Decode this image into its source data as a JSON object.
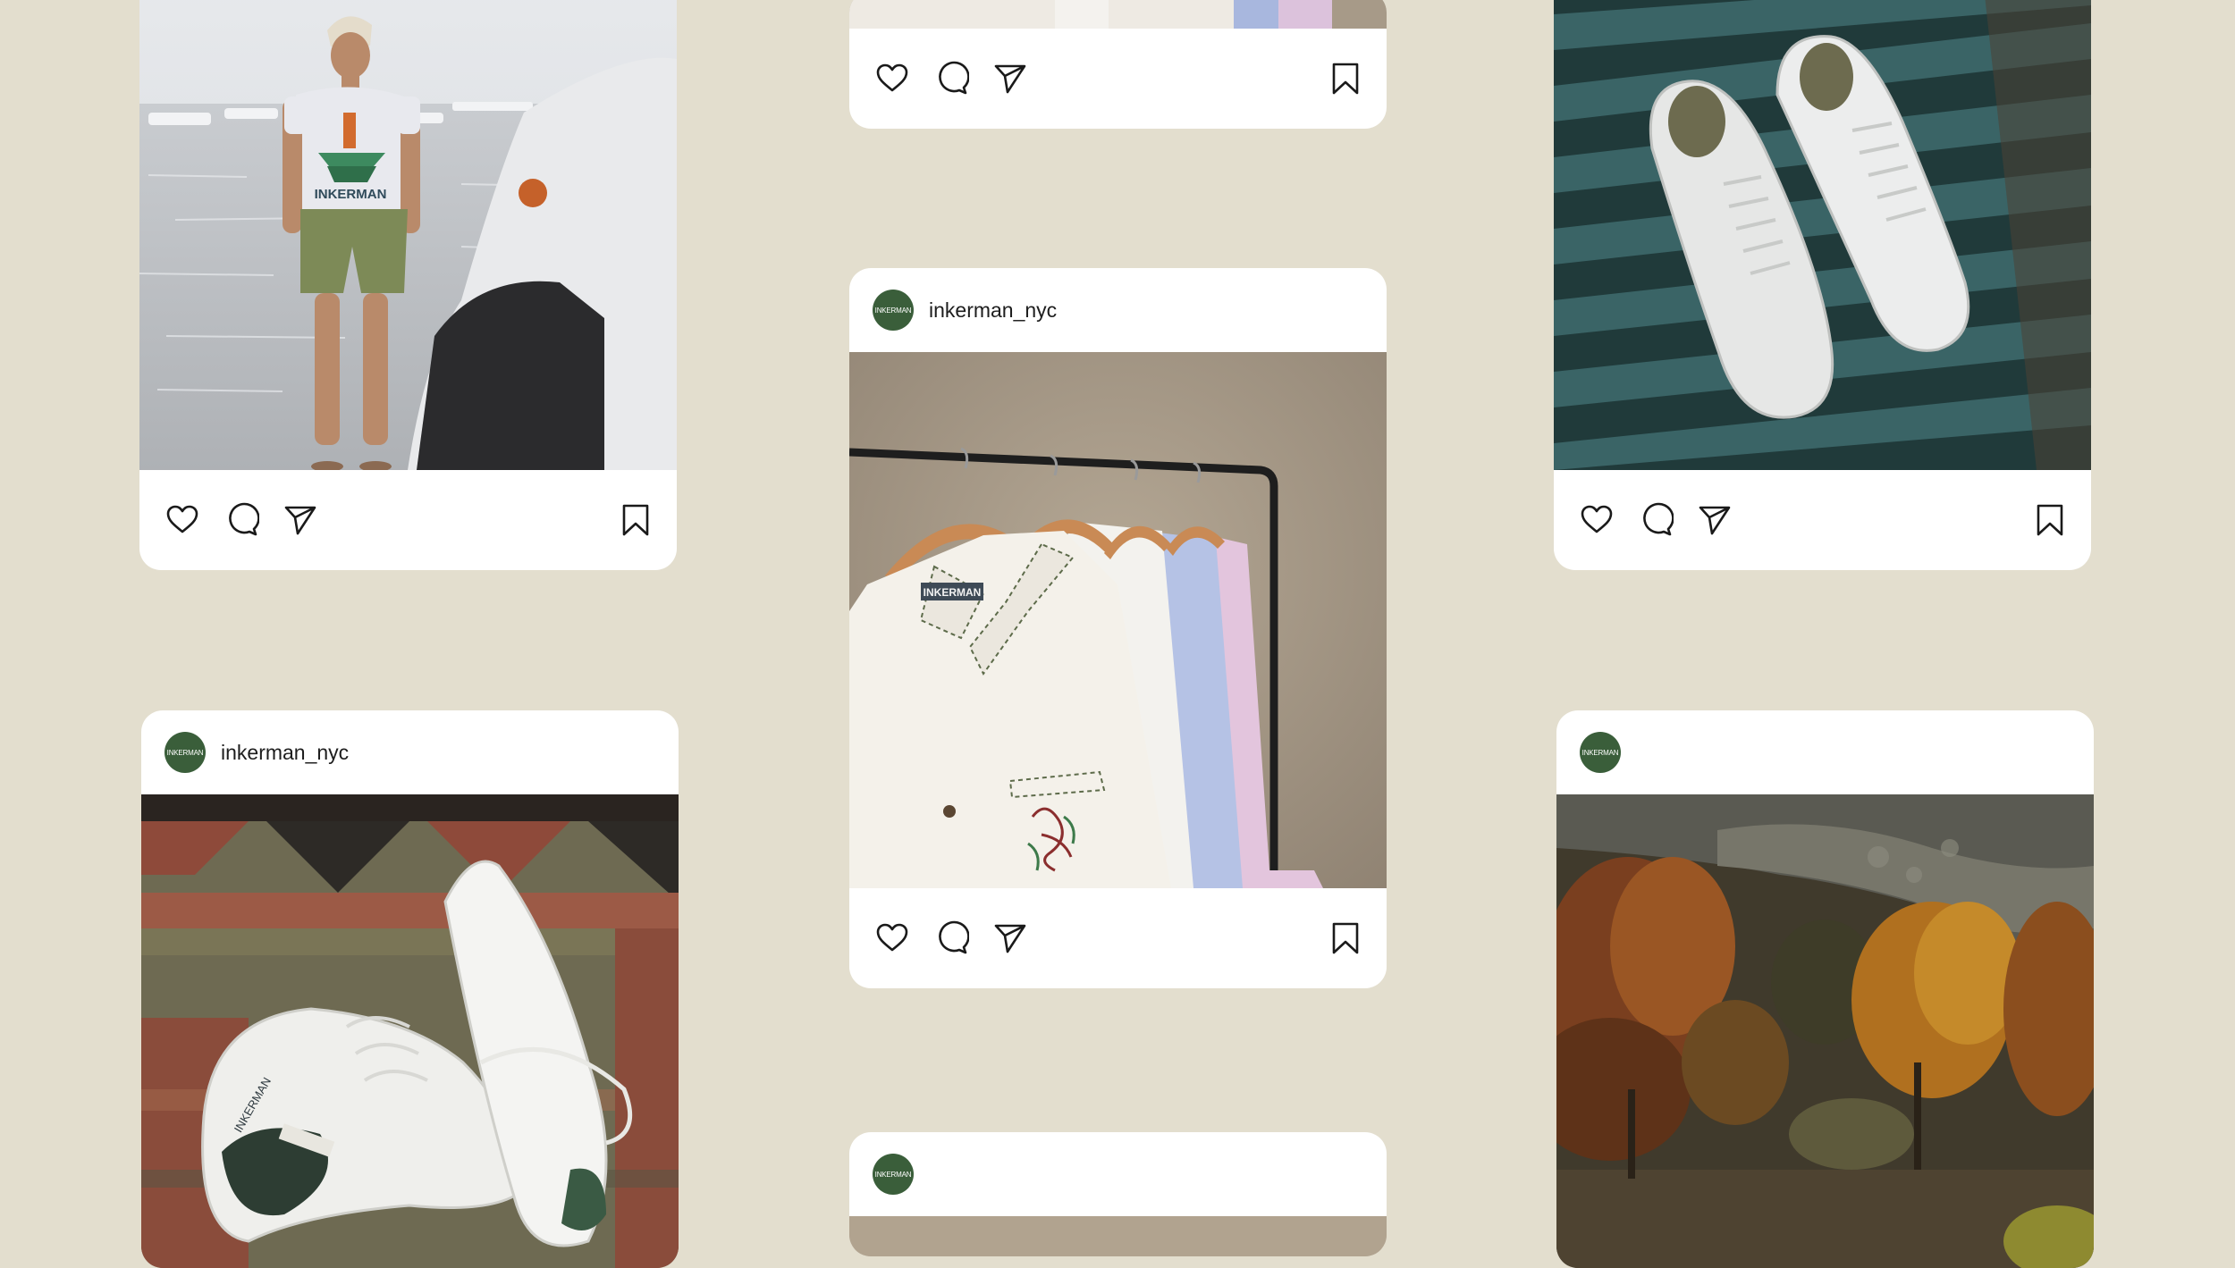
{
  "feed": {
    "posts": [
      {
        "username": "",
        "avatar_text": ""
      },
      {
        "username": "",
        "avatar_text": ""
      },
      {
        "username": "",
        "avatar_text": ""
      },
      {
        "username": "inkerman_nyc",
        "avatar_text": "INKERMAN",
        "photo_text": "INKERMAN"
      },
      {
        "username": "inkerman_nyc",
        "avatar_text": "INKERMAN",
        "photo_text": "INKERMAN"
      },
      {
        "username": "",
        "avatar_text": "INKERMAN"
      },
      {
        "username": "",
        "avatar_text": "INKERMAN"
      }
    ],
    "shirt_print_text": "INKERMAN",
    "icons": [
      "heart-icon",
      "comment-icon",
      "share-icon",
      "bookmark-icon"
    ]
  },
  "colors": {
    "background": "#e3dece",
    "card": "#ffffff",
    "avatar": "#3a5e3a",
    "icon_stroke": "#1a1a1a"
  }
}
